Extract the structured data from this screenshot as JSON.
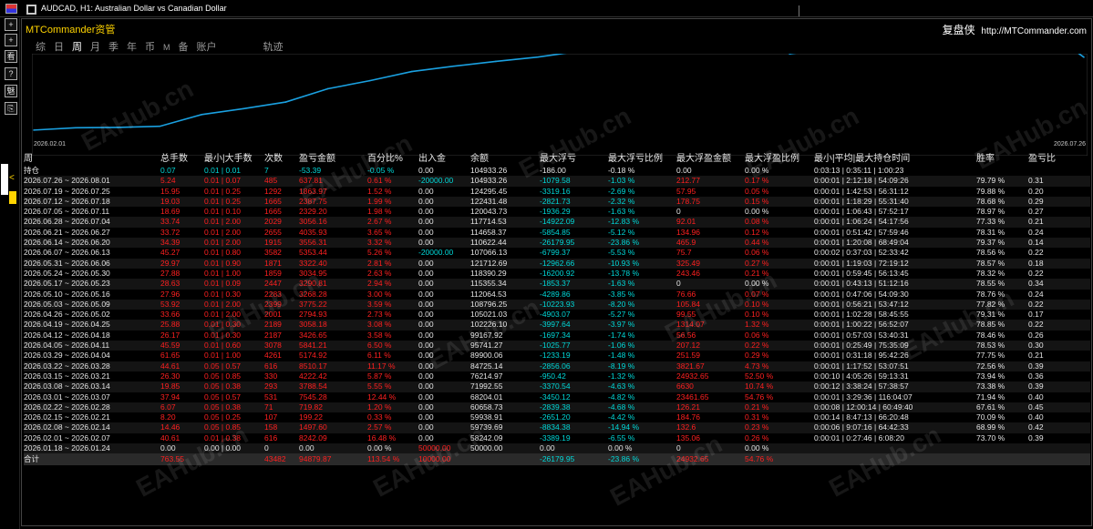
{
  "window": {
    "title": "AUDCAD, H1:  Australian Dollar vs Canadian Dollar"
  },
  "left_toolbar": {
    "items": [
      "+",
      "+",
      "看",
      "?",
      "魅",
      "⎘"
    ],
    "side_arrow": "<"
  },
  "brand": {
    "name": "MTCommander资管",
    "right_cn": "复盘侠",
    "right_url": "http://MTCommander.com"
  },
  "tabs": [
    {
      "label": "综",
      "active": false,
      "small": false
    },
    {
      "label": "日",
      "active": false,
      "small": false
    },
    {
      "label": "周",
      "active": true,
      "small": false
    },
    {
      "label": "月",
      "active": false,
      "small": false
    },
    {
      "label": "季",
      "active": false,
      "small": false
    },
    {
      "label": "年",
      "active": false,
      "small": false
    },
    {
      "label": "币",
      "active": false,
      "small": false
    },
    {
      "label": "M",
      "active": false,
      "small": true
    },
    {
      "label": "备",
      "active": false,
      "small": false
    },
    {
      "label": "账户",
      "active": false,
      "small": false
    },
    {
      "label": "轨迹",
      "active": false,
      "small": false
    }
  ],
  "chart_data": {
    "type": "line",
    "x_start_label": "2026.02.01",
    "x_end_label": "2026.07.26",
    "series_color": "#1aa0e0",
    "ylim": [
      50000,
      106000
    ],
    "x": [
      "2026.02.01",
      "2026.02.08",
      "2026.02.15",
      "2026.02.22",
      "2026.03.01",
      "2026.03.08",
      "2026.03.15",
      "2026.03.22",
      "2026.03.29",
      "2026.04.05",
      "2026.04.12",
      "2026.04.19",
      "2026.04.26",
      "2026.05.03",
      "2026.05.10",
      "2026.05.17",
      "2026.05.24",
      "2026.05.31",
      "2026.06.07",
      "2026.06.14",
      "2026.06.21",
      "2026.06.28",
      "2026.07.05",
      "2026.07.12",
      "2026.07.19",
      "2026.07.26"
    ],
    "values": [
      58242.09,
      59739.69,
      59938.91,
      60658.73,
      68204.01,
      71992.55,
      76214.97,
      84725.14,
      89900.06,
      95741.27,
      99167.92,
      102226.1,
      105021.03,
      108796.25,
      112064.53,
      115355.34,
      118390.29,
      121712.69,
      107066.13,
      110622.44,
      114658.37,
      117714.53,
      120043.73,
      122431.48,
      124295.45,
      104933.26
    ]
  },
  "table": {
    "headers": [
      "周",
      "总手数",
      "最小|大手数",
      "次数",
      "盈亏金额",
      "百分比%",
      "出入金",
      "余额",
      "最大浮亏",
      "最大浮亏比例",
      "最大浮盈金额",
      "最大浮盈比例",
      "最小|平均|最大持仓时间",
      "胜率",
      "盈亏比"
    ],
    "position_row": [
      "持仓",
      "0.07",
      "0.01 | 0.01",
      "7",
      "-53.39",
      "-0.05 %",
      "0.00",
      "104933.26",
      "-186.00",
      "-0.18 %",
      "0.00",
      "0.00 %",
      "0:03:13 | 0:35:11 | 1:00:23",
      "",
      ""
    ],
    "rows": [
      [
        "2026.07.26 ~ 2026.08.01",
        "5.24",
        "0.01 | 0.07",
        "485",
        "637.81",
        "0.61 %",
        "-20000.00",
        "104933.26",
        "-1079.58",
        "-1.03 %",
        "212.77",
        "0.17 %",
        "0:00:01 | 2:12:18 | 54:09:26",
        "79.79 %",
        "0.31"
      ],
      [
        "2026.07.19 ~ 2026.07.25",
        "15.95",
        "0.01 | 0.25",
        "1292",
        "1863.97",
        "1.52 %",
        "0.00",
        "124295.45",
        "-3319.16",
        "-2.69 %",
        "57.95",
        "0.05 %",
        "0:00:01 | 1:42:53 | 56:31:12",
        "79.88 %",
        "0.20"
      ],
      [
        "2026.07.12 ~ 2026.07.18",
        "19.03",
        "0.01 | 0.25",
        "1665",
        "2387.75",
        "1.99 %",
        "0.00",
        "122431.48",
        "-2821.73",
        "-2.32 %",
        "178.75",
        "0.15 %",
        "0:00:01 | 1:18:29 | 55:31:40",
        "78.68 %",
        "0.29"
      ],
      [
        "2026.07.05 ~ 2026.07.11",
        "18.69",
        "0.01 | 0.10",
        "1665",
        "2329.20",
        "1.98 %",
        "0.00",
        "120043.73",
        "-1936.29",
        "-1.63 %",
        "0",
        "0.00 %",
        "0:00:01 | 1:06:43 | 57:52:17",
        "78.97 %",
        "0.27"
      ],
      [
        "2026.06.28 ~ 2026.07.04",
        "33.74",
        "0.01 | 2.00",
        "2029",
        "3056.16",
        "2.67 %",
        "0.00",
        "117714.53",
        "-14922.09",
        "-12.83 %",
        "92.01",
        "0.08 %",
        "0:00:01 | 1:06:24 | 54:17:56",
        "77.33 %",
        "0.21"
      ],
      [
        "2026.06.21 ~ 2026.06.27",
        "33.72",
        "0.01 | 2.00",
        "2655",
        "4035.93",
        "3.65 %",
        "0.00",
        "114658.37",
        "-5854.85",
        "-5.12 %",
        "134.96",
        "0.12 %",
        "0:00:01 | 0:51:42 | 57:59:46",
        "78.31 %",
        "0.24"
      ],
      [
        "2026.06.14 ~ 2026.06.20",
        "34.39",
        "0.01 | 2.00",
        "1915",
        "3556.31",
        "3.32 %",
        "0.00",
        "110622.44",
        "-26179.95",
        "-23.86 %",
        "465.9",
        "0.44 %",
        "0:00:01 | 1:20:08 | 68:49:04",
        "79.37 %",
        "0.14"
      ],
      [
        "2026.06.07 ~ 2026.06.13",
        "45.27",
        "0.01 | 0.80",
        "3582",
        "5353.44",
        "5.26 %",
        "-20000.00",
        "107066.13",
        "-6799.37",
        "-5.53 %",
        "75.7",
        "0.06 %",
        "0:00:02 | 0:37:03 | 52:33:42",
        "78.56 %",
        "0.22"
      ],
      [
        "2026.05.31 ~ 2026.06.06",
        "29.97",
        "0.01 | 0.90",
        "1871",
        "3322.40",
        "2.81 %",
        "0.00",
        "121712.69",
        "-12962.66",
        "-10.93 %",
        "325.49",
        "0.27 %",
        "0:00:01 | 1:19:03 | 72:19:12",
        "78.57 %",
        "0.18"
      ],
      [
        "2026.05.24 ~ 2026.05.30",
        "27.88",
        "0.01 | 1.00",
        "1859",
        "3034.95",
        "2.63 %",
        "0.00",
        "118390.29",
        "-16200.92",
        "-13.78 %",
        "243.46",
        "0.21 %",
        "0:00:01 | 0:59:45 | 56:13:45",
        "78.32 %",
        "0.22"
      ],
      [
        "2026.05.17 ~ 2026.05.23",
        "28.63",
        "0.01 | 0.09",
        "2447",
        "3290.81",
        "2.94 %",
        "0.00",
        "115355.34",
        "-1853.37",
        "-1.63 %",
        "0",
        "0.00 %",
        "0:00:01 | 0:43:13 | 51:12:16",
        "78.55 %",
        "0.34"
      ],
      [
        "2026.05.10 ~ 2026.05.16",
        "27.96",
        "0.01 | 0.30",
        "2283",
        "3268.28",
        "3.00 %",
        "0.00",
        "112064.53",
        "-4289.86",
        "-3.85 %",
        "76.66",
        "0.07 %",
        "0:00:01 | 0:47:06 | 54:09:30",
        "78.76 %",
        "0.24"
      ],
      [
        "2026.05.03 ~ 2026.05.09",
        "53.92",
        "0.01 | 2.00",
        "2399",
        "3775.22",
        "3.59 %",
        "0.00",
        "108796.25",
        "-10223.93",
        "-8.20 %",
        "105.84",
        "0.10 %",
        "0:00:01 | 0:56:21 | 53:47:12",
        "77.82 %",
        "0.22"
      ],
      [
        "2026.04.26 ~ 2026.05.02",
        "33.66",
        "0.01 | 2.00",
        "2001",
        "2794.93",
        "2.73 %",
        "0.00",
        "105021.03",
        "-4903.07",
        "-5.27 %",
        "99.55",
        "0.10 %",
        "0:00:01 | 1:02:28 | 58:45:55",
        "79.31 %",
        "0.17"
      ],
      [
        "2026.04.19 ~ 2026.04.25",
        "25.88",
        "0.01 | 0.30",
        "2189",
        "3058.18",
        "3.08 %",
        "0.00",
        "102226.10",
        "-3997.64",
        "-3.97 %",
        "1314.07",
        "1.32 %",
        "0:00:01 | 1:00:22 | 56:52:07",
        "78.85 %",
        "0.22"
      ],
      [
        "2026.04.12 ~ 2026.04.18",
        "26.17",
        "0.01 | 0.30",
        "2187",
        "3426.65",
        "3.58 %",
        "0.00",
        "99167.92",
        "-1697.34",
        "-1.74 %",
        "56.56",
        "0.06 %",
        "0:00:01 | 0:57:03 | 53:40:31",
        "78.46 %",
        "0.26"
      ],
      [
        "2026.04.05 ~ 2026.04.11",
        "45.59",
        "0.01 | 0.60",
        "3078",
        "5841.21",
        "6.50 %",
        "0.00",
        "95741.27",
        "-1025.77",
        "-1.06 %",
        "207.12",
        "0.22 %",
        "0:00:01 | 0:25:49 | 75:35:09",
        "78.53 %",
        "0.30"
      ],
      [
        "2026.03.29 ~ 2026.04.04",
        "61.65",
        "0.01 | 1.00",
        "4261",
        "5174.92",
        "6.11 %",
        "0.00",
        "89900.06",
        "-1233.19",
        "-1.48 %",
        "251.59",
        "0.29 %",
        "0:00:01 | 0:31:18 | 95:42:26",
        "77.75 %",
        "0.21"
      ],
      [
        "2026.03.22 ~ 2026.03.28",
        "44.61",
        "0.05 | 0.57",
        "616",
        "8510.17",
        "11.17 %",
        "0.00",
        "84725.14",
        "-2856.06",
        "-8.19 %",
        "3821.67",
        "4.73 %",
        "0:00:01 | 1:17:52 | 53:07:51",
        "72.56 %",
        "0.39"
      ],
      [
        "2026.03.15 ~ 2026.03.21",
        "26.30",
        "0.05 | 0.85",
        "330",
        "4222.42",
        "5.87 %",
        "0.00",
        "76214.97",
        "-950.42",
        "-1.32 %",
        "24932.65",
        "52.50 %",
        "0:00:10 | 4:05:26 | 59:13:31",
        "73.94 %",
        "0.36"
      ],
      [
        "2026.03.08 ~ 2026.03.14",
        "19.85",
        "0.05 | 0.38",
        "293",
        "3788.54",
        "5.55 %",
        "0.00",
        "71992.55",
        "-3370.54",
        "-4.63 %",
        "6630",
        "10.74 %",
        "0:00:12 | 3:38:24 | 57:38:57",
        "73.38 %",
        "0.39"
      ],
      [
        "2026.03.01 ~ 2026.03.07",
        "37.94",
        "0.05 | 0.57",
        "531",
        "7545.28",
        "12.44 %",
        "0.00",
        "68204.01",
        "-3450.12",
        "-4.82 %",
        "23461.65",
        "54.76 %",
        "0:00:01 | 3:29:36 | 116:04:07",
        "71.94 %",
        "0.40"
      ],
      [
        "2026.02.22 ~ 2026.02.28",
        "6.07",
        "0.05 | 0.38",
        "71",
        "719.82",
        "1.20 %",
        "0.00",
        "60658.73",
        "-2839.38",
        "-4.68 %",
        "126.21",
        "0.21 %",
        "0:00:08 | 12:00:14 | 60:49:40",
        "67.61 %",
        "0.45"
      ],
      [
        "2026.02.15 ~ 2026.02.21",
        "8.20",
        "0.05 | 0.25",
        "107",
        "199.22",
        "0.33 %",
        "0.00",
        "59938.91",
        "-2651.20",
        "-4.42 %",
        "184.76",
        "0.31 %",
        "0:00:14 | 8:47:13 | 66:20:48",
        "70.09 %",
        "0.40"
      ],
      [
        "2026.02.08 ~ 2026.02.14",
        "14.46",
        "0.05 | 0.85",
        "158",
        "1497.60",
        "2.57 %",
        "0.00",
        "59739.69",
        "-8834.38",
        "-14.94 %",
        "132.6",
        "0.23 %",
        "0:00:06 | 9:07:16 | 64:42:33",
        "68.99 %",
        "0.42"
      ],
      [
        "2026.02.01 ~ 2026.02.07",
        "40.61",
        "0.01 | 0.38",
        "616",
        "8242.09",
        "16.48 %",
        "0.00",
        "58242.09",
        "-3389.19",
        "-6.55 %",
        "135.06",
        "0.26 %",
        "0:00:01 | 0:27:46 | 6:08:20",
        "73.70 %",
        "0.39"
      ],
      [
        "2026.01.18 ~ 2026.01.24",
        "0.00",
        "0.00 | 0.00",
        "0",
        "0.00",
        "0.00 %",
        "50000.00",
        "50000.00",
        "0.00",
        "0.00 %",
        "0",
        "0.00 %",
        "",
        "",
        ""
      ]
    ],
    "total_row": [
      "合计",
      "763.55",
      "",
      "43482",
      "94879.87",
      "113.54 %",
      "10000.00",
      "",
      "-26179.95",
      "-23.86 %",
      "24932.65",
      "54.76 %",
      "",
      "",
      ""
    ]
  },
  "watermark": "EAHub.cn",
  "colors": {
    "brand": "#ffd400",
    "accent": "#00d8d8",
    "profit": "#ff2020",
    "line": "#1aa0e0"
  }
}
